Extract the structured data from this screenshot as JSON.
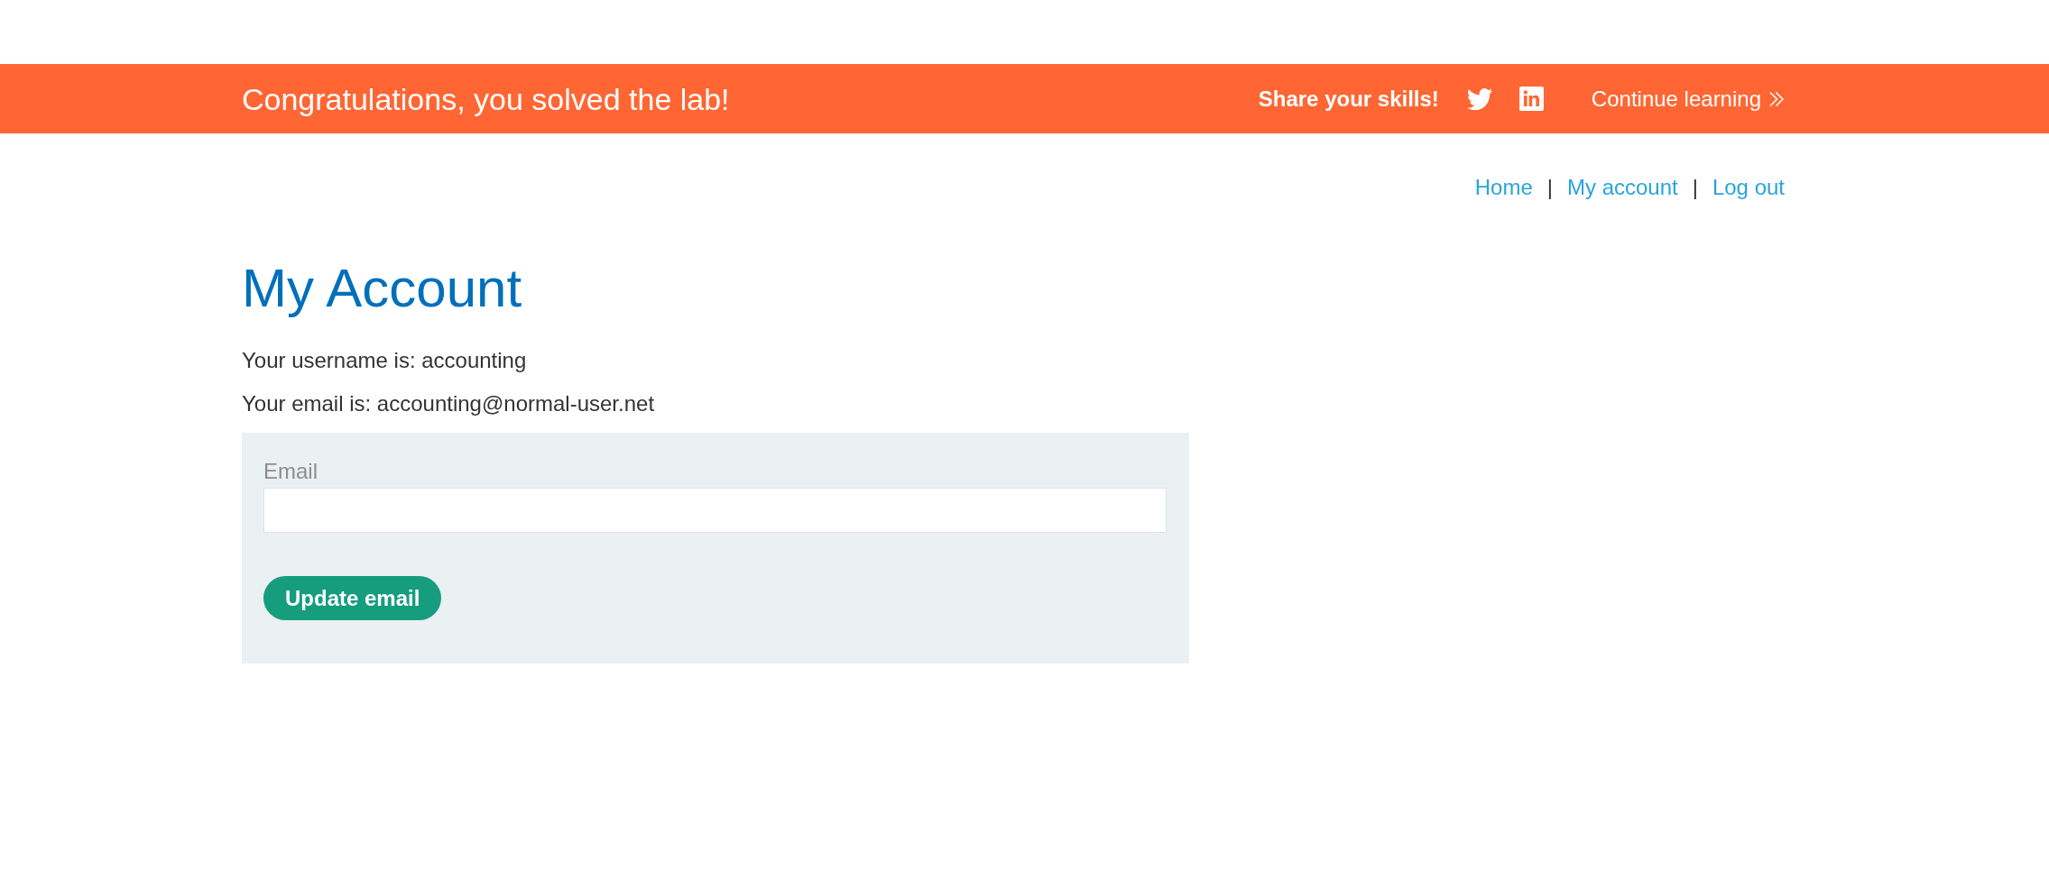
{
  "banner": {
    "title": "Congratulations, you solved the lab!",
    "share_label": "Share your skills!",
    "continue_link": "Continue learning"
  },
  "nav": [
    {
      "kind": "link",
      "label": "Home"
    },
    {
      "kind": "separator",
      "label": "|"
    },
    {
      "kind": "link",
      "label": "My account"
    },
    {
      "kind": "separator",
      "label": "|"
    },
    {
      "kind": "link",
      "label": "Log out"
    }
  ],
  "page": {
    "heading": "My Account",
    "details": [
      "Your username is: accounting",
      "Your email is: accounting@normal-user.net"
    ],
    "form": {
      "field_label": "Email",
      "button": "Update email"
    }
  }
}
